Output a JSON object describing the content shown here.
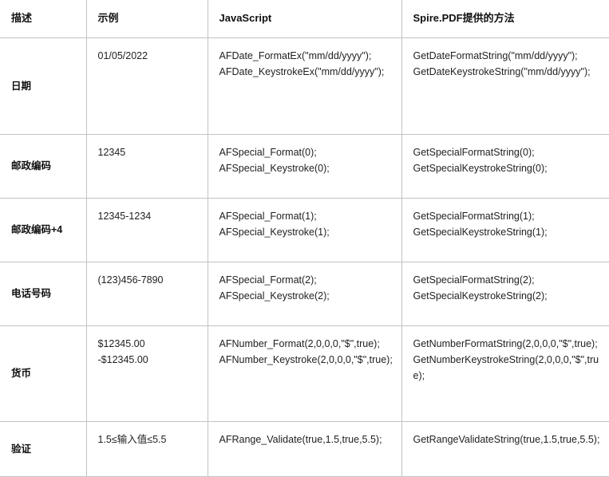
{
  "table": {
    "columns": [
      {
        "key": "description",
        "label": "描述"
      },
      {
        "key": "example",
        "label": "示例"
      },
      {
        "key": "javascript",
        "label": "JavaScript"
      },
      {
        "key": "spire",
        "label": "Spire.PDF提供的方法"
      }
    ],
    "rows": [
      {
        "description": "日期",
        "example": "01/05/2022",
        "javascript": "AFDate_FormatEx(\"mm/dd/yyyy\");\nAFDate_KeystrokeEx(\"mm/dd/yyyy\");",
        "spire": "GetDateFormatString(\"mm/dd/yyyy\");\nGetDateKeystrokeString(\"mm/dd/yyyy\");"
      },
      {
        "description": "邮政编码",
        "example": "12345",
        "javascript": "AFSpecial_Format(0);\nAFSpecial_Keystroke(0);",
        "spire": "GetSpecialFormatString(0);\nGetSpecialKeystrokeString(0);"
      },
      {
        "description": "邮政编码+4",
        "example": "12345-1234",
        "javascript": "AFSpecial_Format(1);\nAFSpecial_Keystroke(1);",
        "spire": "GetSpecialFormatString(1);\nGetSpecialKeystrokeString(1);"
      },
      {
        "description": "电话号码",
        "example": "(123)456-7890",
        "javascript": "AFSpecial_Format(2);\nAFSpecial_Keystroke(2);",
        "spire": "GetSpecialFormatString(2);\nGetSpecialKeystrokeString(2);"
      },
      {
        "description": "货币",
        "example": "$12345.00\n-$12345.00",
        "javascript": "AFNumber_Format(2,0,0,0,\"$\",true);\nAFNumber_Keystroke(2,0,0,0,\"$\",true);",
        "spire": "GetNumberFormatString(2,0,0,0,\"$\",true);\nGetNumberKeystrokeString(2,0,0,0,\"$\",true);"
      },
      {
        "description": "验证",
        "example": "1.5≤输入值≤5.5",
        "javascript": "AFRange_Validate(true,1.5,true,5.5);",
        "spire": "GetRangeValidateString(true,1.5,true,5.5);"
      }
    ]
  },
  "colors": {
    "border": "#c2c2c2",
    "text": "#1f1f1f",
    "header_text": "#111111",
    "background": "#ffffff"
  }
}
